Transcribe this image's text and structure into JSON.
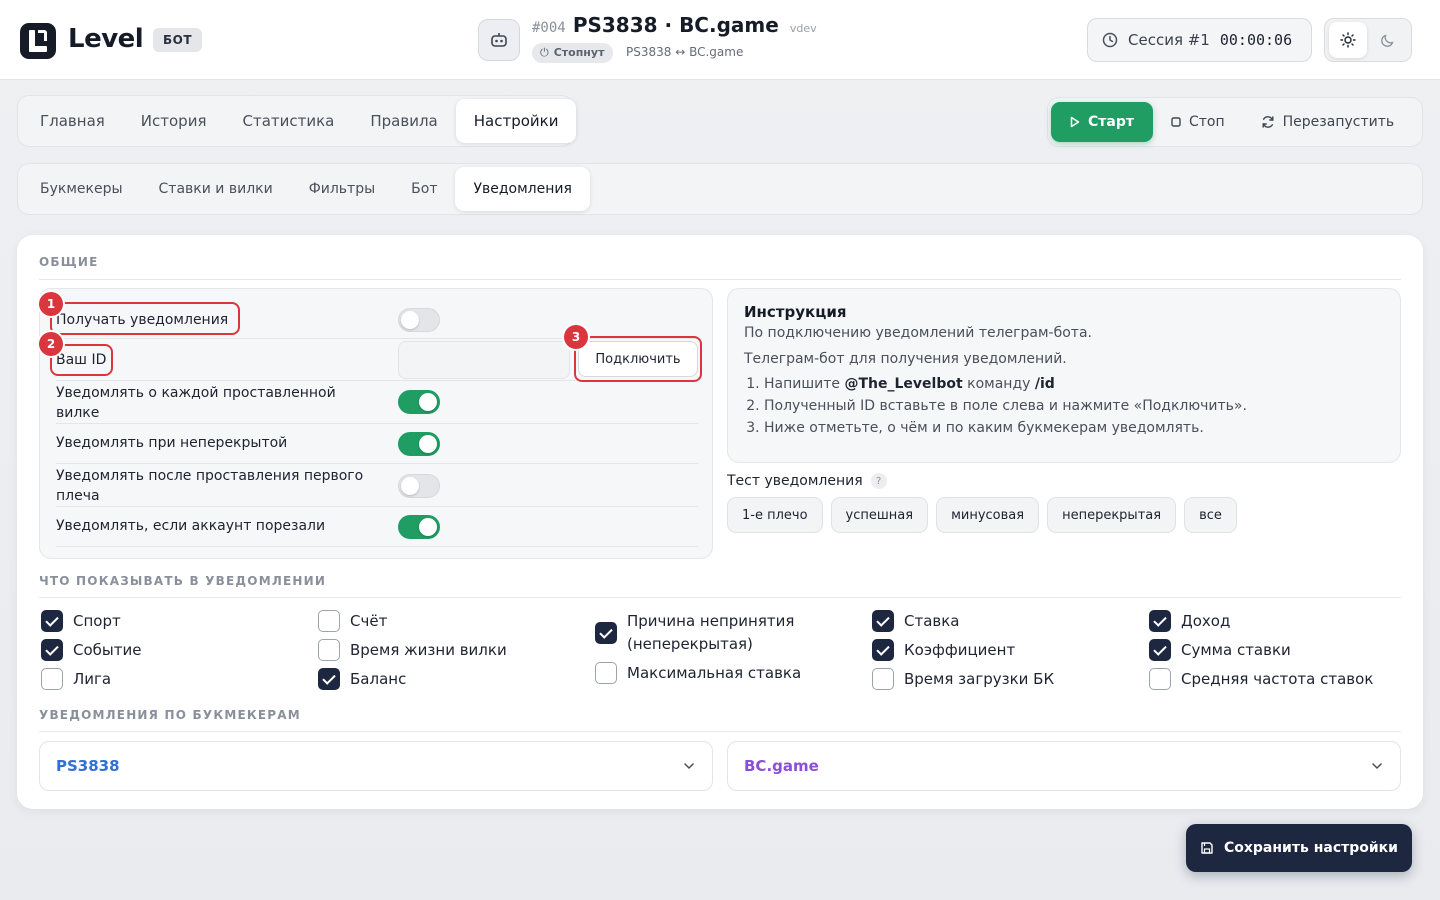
{
  "header": {
    "logo_text": "Level",
    "badge": "БОТ",
    "bot_number": "#004",
    "bot_name": "PS3838 · BC.game",
    "bot_env": "vdev",
    "status": "Стопнут",
    "pair": "PS3838 ↔ BC.game",
    "session_label": "Сессия #1",
    "session_timer": "00:00:06",
    "icons": {
      "robot": "robot-icon",
      "clock": "clock-icon",
      "sun": "sun-icon",
      "moon": "moon-icon",
      "power": "power-icon"
    }
  },
  "main_tabs": [
    "Главная",
    "История",
    "Статистика",
    "Правила",
    "Настройки"
  ],
  "active_main_tab": "Настройки",
  "actions": {
    "start": "Старт",
    "stop": "Стоп",
    "restart": "Перезапустить",
    "start_color": "#1f9d63"
  },
  "sub_tabs": [
    "Букмекеры",
    "Ставки и вилки",
    "Фильтры",
    "Бот",
    "Уведомления"
  ],
  "active_sub_tab": "Уведомления",
  "general": {
    "section_title": "ОБЩИЕ",
    "receive_label": "Получать уведомления",
    "receive_on": false,
    "id_label": "Ваш ID",
    "id_value": "",
    "connect_button": "Подключить",
    "rows": [
      {
        "label": "Уведомлять о каждой проставленной вилке",
        "on": true
      },
      {
        "label": "Уведомлять при неперекрытой",
        "on": true
      },
      {
        "label": "Уведомлять после проставления первого плеча",
        "on": false
      },
      {
        "label": "Уведомлять, если аккаунт порезали",
        "on": true
      }
    ],
    "markers": [
      "1",
      "2",
      "3"
    ],
    "highlight_color": "#d9363e"
  },
  "instruction": {
    "title": "Инструкция",
    "subtitle": "По подключению уведомлений телеграм-бота.",
    "intro": "Телеграм-бот для получения уведомлений.",
    "step1_prefix": "Напишите ",
    "step1_bot": "@The_Levelbot",
    "step1_mid": " команду ",
    "step1_cmd": "/id",
    "step2": "Полученный ID вставьте в поле слева и нажмите «Подключить».",
    "step3": "Ниже отметьте, о чём и по каким букмекерам уведомлять."
  },
  "test": {
    "label": "Тест уведомления",
    "help": "?",
    "buttons": [
      "1-е плечо",
      "успешная",
      "минусовая",
      "неперекрытая",
      "все"
    ]
  },
  "display": {
    "section_title": "ЧТО ПОКАЗЫВАТЬ В УВЕДОМЛЕНИИ",
    "columns": [
      [
        {
          "label": "Спорт",
          "checked": true
        },
        {
          "label": "Событие",
          "checked": true
        },
        {
          "label": "Лига",
          "checked": false
        }
      ],
      [
        {
          "label": "Счёт",
          "checked": false
        },
        {
          "label": "Время жизни вилки",
          "checked": false
        },
        {
          "label": "Баланс",
          "checked": true
        }
      ],
      [
        {
          "label": "Причина непринятия (неперекрытая)",
          "checked": true
        },
        {
          "label": "Максимальная ставка",
          "checked": false
        }
      ],
      [
        {
          "label": "Ставка",
          "checked": true
        },
        {
          "label": "Коэффициент",
          "checked": true
        },
        {
          "label": "Время загрузки БК",
          "checked": false
        }
      ],
      [
        {
          "label": "Доход",
          "checked": true
        },
        {
          "label": "Сумма ставки",
          "checked": true
        },
        {
          "label": "Средняя частота ставок",
          "checked": false
        }
      ]
    ]
  },
  "bookmakers": {
    "section_title": "УВЕДОМЛЕНИЯ ПО БУКМЕКЕРАМ",
    "items": [
      {
        "name": "PS3838",
        "color": "#2f6fd6"
      },
      {
        "name": "BC.game",
        "color": "#8a4fd6"
      }
    ]
  },
  "save_button": "Сохранить настройки"
}
